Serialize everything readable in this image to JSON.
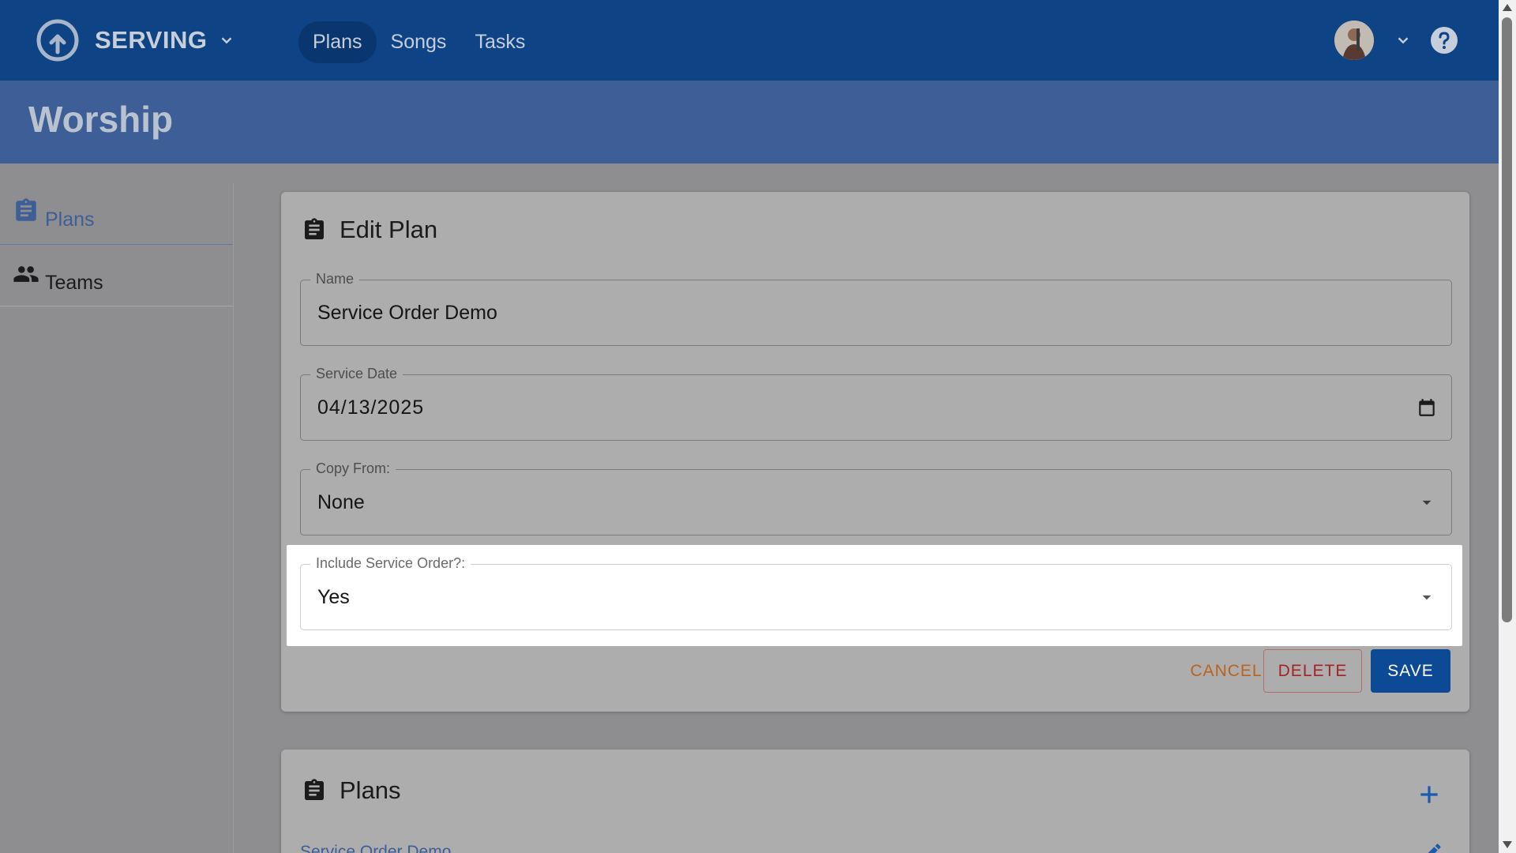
{
  "app": {
    "brand": "SERVING",
    "nav": [
      {
        "label": "Plans",
        "active": true
      },
      {
        "label": "Songs",
        "active": false
      },
      {
        "label": "Tasks",
        "active": false
      }
    ],
    "icons": {
      "logo": "serving-logo-icon",
      "brand_menu": "chevron-down-icon",
      "user_menu": "chevron-down-icon",
      "help": "help-circle-icon"
    }
  },
  "header": {
    "title": "Worship"
  },
  "sidebar": {
    "items": [
      {
        "label": "Plans",
        "icon": "clipboard-icon",
        "active": true
      },
      {
        "label": "Teams",
        "icon": "people-icon",
        "active": false
      }
    ]
  },
  "edit_plan": {
    "title": "Edit Plan",
    "name": {
      "label": "Name",
      "value": "Service Order Demo"
    },
    "service_date": {
      "label": "Service Date",
      "value": "04/13/2025"
    },
    "copy_from": {
      "label": "Copy From:",
      "value": "None"
    },
    "include_service_order": {
      "label": "Include Service Order?:",
      "value": "Yes"
    },
    "buttons": {
      "cancel": "CANCEL",
      "delete": "DELETE",
      "save": "SAVE"
    }
  },
  "plans_panel": {
    "title": "Plans",
    "items": [
      {
        "label": "Service Order Demo"
      }
    ]
  },
  "colors": {
    "topbar": "#0e4385",
    "header_band": "#3d5e96",
    "save_button": "#0d4a96",
    "delete_text": "#a32424",
    "cancel_text": "#b8641e"
  }
}
